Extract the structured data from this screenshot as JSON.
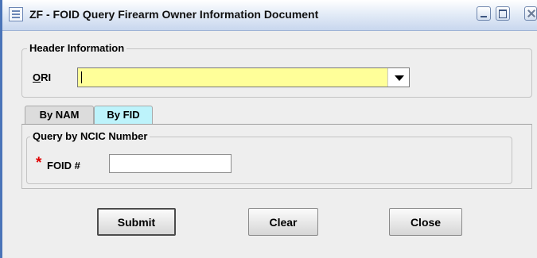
{
  "window": {
    "title": "ZF - FOID Query Firearm Owner Information Document",
    "icons": [
      "app-icon",
      "minimize-icon",
      "maximize-icon",
      "close-icon"
    ]
  },
  "header": {
    "legend": "Header Information",
    "ori_label": "ORI",
    "ori_mnemonic": "O",
    "ori_label_rest": "RI",
    "ori_value": "",
    "ori_field_color": "#ffff99"
  },
  "tabs": [
    {
      "label": "By NAM",
      "selected": false
    },
    {
      "label": "By FID",
      "selected": true,
      "color": "#bdf3fb"
    }
  ],
  "query": {
    "legend": "Query by NCIC Number",
    "required_mark": "*",
    "foid_label": "FOID #",
    "foid_value": ""
  },
  "buttons": {
    "submit": "Submit",
    "clear": "Clear",
    "close": "Close"
  }
}
